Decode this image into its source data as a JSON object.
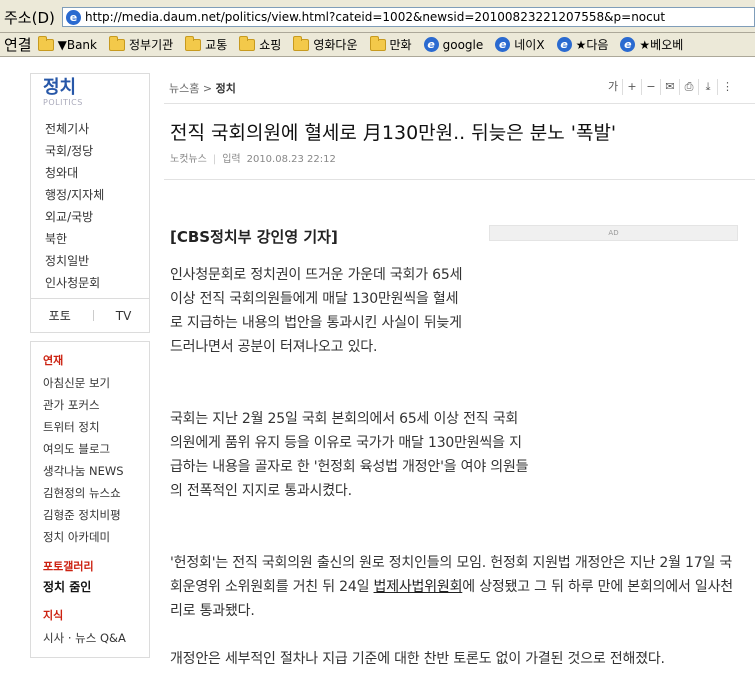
{
  "browser": {
    "address_label": "주소(D)",
    "url": "http://media.daum.net/politics/view.html?cateid=1002&newsid=20100823221207558&p=nocut",
    "links_label": "연결",
    "links": [
      {
        "label": "▼Bank",
        "icon": "folder-icon"
      },
      {
        "label": "정부기관",
        "icon": "folder-icon"
      },
      {
        "label": "교통",
        "icon": "folder-icon"
      },
      {
        "label": "쇼핑",
        "icon": "folder-icon"
      },
      {
        "label": "영화다운",
        "icon": "folder-icon"
      },
      {
        "label": "만화",
        "icon": "folder-icon"
      },
      {
        "label": "google",
        "icon": "ie-icon"
      },
      {
        "label": "네이X",
        "icon": "ie-icon"
      },
      {
        "label": "★다음",
        "icon": "ie-icon"
      },
      {
        "label": "★베오베",
        "icon": "ie-icon"
      }
    ]
  },
  "sidebar": {
    "section_title": "정치",
    "section_sub": "POLITICS",
    "menu": [
      "전체기사",
      "국회/정당",
      "청와대",
      "행정/지자체",
      "외교/국방",
      "북한",
      "정치일반",
      "인사청문회"
    ],
    "photo": "포토",
    "tv": "TV",
    "series_head": "연재",
    "series": [
      "아침신문 보기",
      "관가 포커스",
      "트위터 정치",
      "여의도 블로그",
      "생각나눔 NEWS",
      "김현정의 뉴스쇼",
      "김형준 정치비평",
      "정치 아카데미"
    ],
    "gallery_head": "포토갤러리",
    "gallery_item": "정치 줌인",
    "jisik_head": "지식",
    "jisik_item": "시사 · 뉴스 Q&A"
  },
  "article": {
    "breadcrumb_home": "뉴스홈",
    "breadcrumb_sep": " > ",
    "breadcrumb_section": "정치",
    "tools": [
      "가",
      "+",
      "−",
      "✉",
      "⎙",
      "⤓",
      "⋮"
    ],
    "title": "전직 국회의원에 혈세로 月130만원.. 뒤늦은 분노 '폭발'",
    "source": "노컷뉴스",
    "input_label": "입력",
    "date": "2010.08.23 22:12",
    "byline": "[CBS정치부 강인영 기자]",
    "ad_label": "AD",
    "para1": "인사청문회로 정치권이 뜨거운 가운데 국회가 65세 이상 전직 국회의원들에게 매달 130만원씩을 혈세로 지급하는 내용의 법안을 통과시킨 사실이 뒤늦게 드러나면서 공분이 터져나오고 있다.",
    "para2": "국회는 지난 2월 25일 국회 본회의에서 65세 이상 전직 국회의원에게 품위 유지 등을 이유로 국가가 매달 130만원씩을 지급하는 내용을 골자로 한 '헌정회 육성법 개정안'을 여야 의원들의 전폭적인 지지로 통과시켰다.",
    "para3_a": "'헌정회'는 전직 국회의원 출신의 원로 정치인들의 모임. 헌정회 지원법 개정안은 지난 2월 17일 국회운영위 소위원회를 거친 뒤 24일 ",
    "para3_link": "법제사법위원회",
    "para3_b": "에 상정됐고 그 뒤 하루 만에 본회의에서 일사천리로 통과됐다.",
    "para4": "개정안은 세부적인 절차나 지급 기준에 대한 찬반 토론도 없이 가결된 것으로 전해졌다."
  }
}
